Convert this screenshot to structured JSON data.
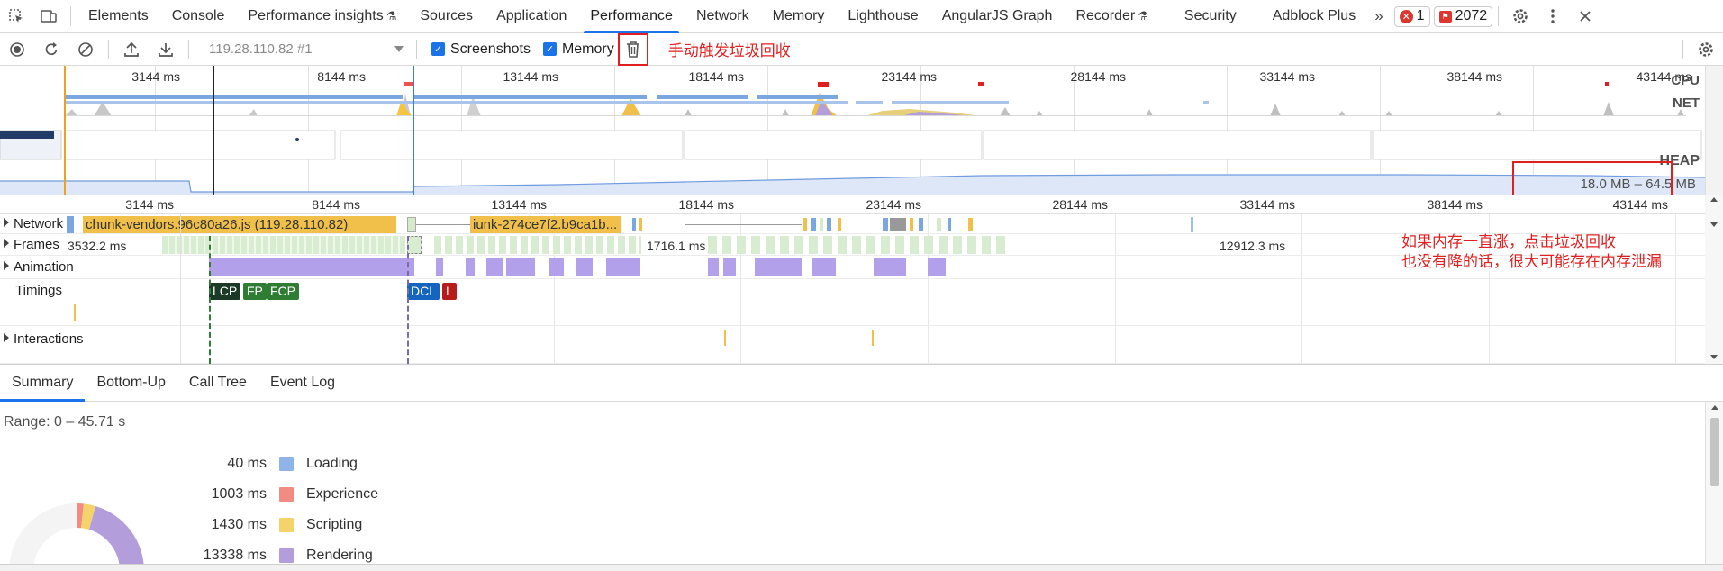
{
  "tabs": {
    "items": [
      {
        "label": "Elements"
      },
      {
        "label": "Console"
      },
      {
        "label": "Performance insights"
      },
      {
        "label": "Sources"
      },
      {
        "label": "Application"
      },
      {
        "label": "Performance"
      },
      {
        "label": "Network"
      },
      {
        "label": "Memory"
      },
      {
        "label": "Lighthouse"
      },
      {
        "label": "AngularJS Graph"
      },
      {
        "label": "Recorder"
      },
      {
        "label": "Security"
      },
      {
        "label": "Adblock Plus"
      }
    ],
    "more": "»",
    "errors_count": "1",
    "issues_count": "2072"
  },
  "toolbar": {
    "profile": "119.28.110.82 #1",
    "screenshots_label": "Screenshots",
    "memory_label": "Memory",
    "gc_annotation": "手动触发垃圾回收"
  },
  "overview": {
    "ticks": [
      "3144 ms",
      "8144 ms",
      "13144 ms",
      "18144 ms",
      "23144 ms",
      "28144 ms",
      "33144 ms",
      "38144 ms",
      "43144 ms"
    ],
    "cpu_label": "CPU",
    "net_label": "NET",
    "heap_label": "HEAP",
    "heap_range": "18.0 MB – 64.5 MB"
  },
  "ruler": {
    "ticks": [
      "3144 ms",
      "8144 ms",
      "13144 ms",
      "18144 ms",
      "23144 ms",
      "28144 ms",
      "33144 ms",
      "38144 ms",
      "43144 ms"
    ]
  },
  "tracks": {
    "network_label": "Network",
    "net_request_1": "chunk-vendors.96c80a26.js (119.28.110.82)",
    "net_request_2": "iunk-274ce7f2.b9ca1b...",
    "frames_label": "Frames",
    "frame_time_1": "3532.2 ms",
    "frame_time_2": "1716.1 ms",
    "frame_time_3": "12912.3 ms",
    "animation_label": "Animation",
    "timings_label": "Timings",
    "timing_marks": [
      "LCP",
      "FP",
      "FCP",
      "DCL",
      "L"
    ],
    "interactions_label": "Interactions",
    "leak_annotation_1": "如果内存一直涨，点击垃圾回收",
    "leak_annotation_2": "也没有降的话，很大可能存在内存泄漏"
  },
  "bottom": {
    "tabs": [
      "Summary",
      "Bottom-Up",
      "Call Tree",
      "Event Log"
    ],
    "range": "Range: 0 – 45.71 s",
    "legend": [
      {
        "ms": "40 ms",
        "name": "Loading",
        "color": "#8fb3e8"
      },
      {
        "ms": "1003 ms",
        "name": "Experience",
        "color": "#f28b82"
      },
      {
        "ms": "1430 ms",
        "name": "Scripting",
        "color": "#f5d36b"
      },
      {
        "ms": "13338 ms",
        "name": "Rendering",
        "color": "#b39ddb"
      }
    ]
  },
  "colors": {
    "accent": "#1a73e8",
    "annotation": "#e02020",
    "scripting": "#f0c04b",
    "rendering": "#b3a0ea",
    "frames": "#d7ecd0"
  }
}
